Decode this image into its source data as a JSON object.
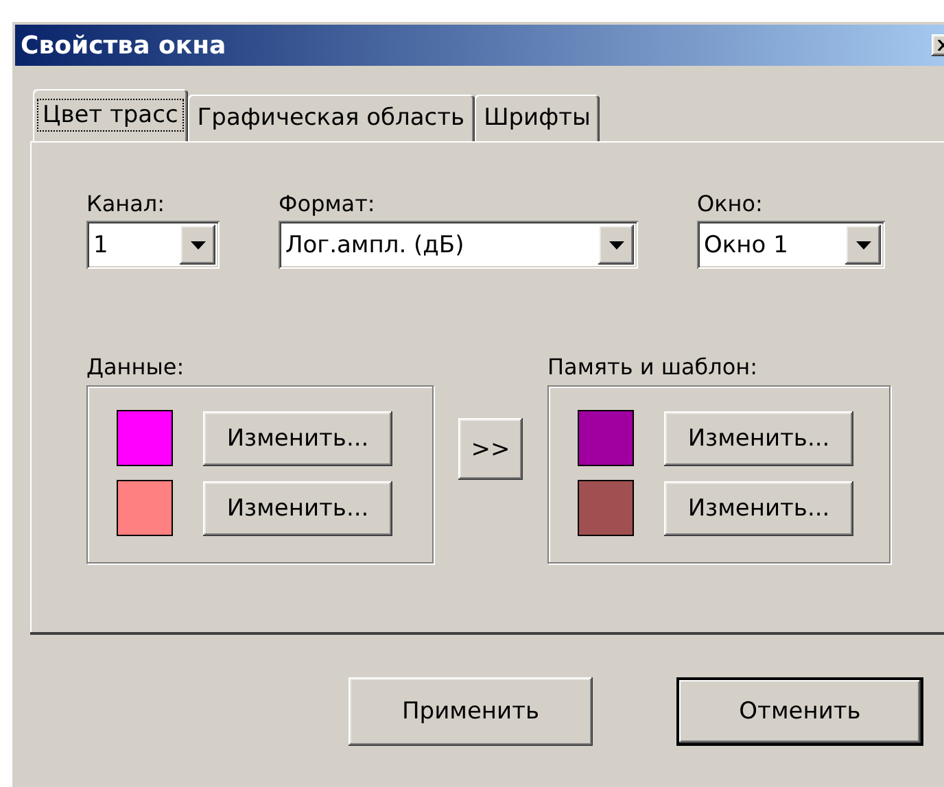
{
  "window": {
    "title": "Свойства окна"
  },
  "tabs": [
    {
      "label": "Цвет трасс",
      "selected": true
    },
    {
      "label": "Графическая область",
      "selected": false
    },
    {
      "label": "Шрифты",
      "selected": false
    }
  ],
  "selectors": [
    {
      "label": "Канал:",
      "value": "1"
    },
    {
      "label": "Формат:",
      "value": "Лог.ампл. (дБ)"
    },
    {
      "label": "Окно:",
      "value": "Окно 1"
    }
  ],
  "data_group": {
    "label": "Данные:",
    "rows": [
      {
        "color": "#ff00ff",
        "button": "Изменить..."
      },
      {
        "color": "#ff8080",
        "button": "Изменить..."
      }
    ]
  },
  "copy_button": ">>",
  "memory_group": {
    "label": "Память и шаблон:",
    "rows": [
      {
        "color": "#a000a0",
        "button": "Изменить..."
      },
      {
        "color": "#a05050",
        "button": "Изменить..."
      }
    ]
  },
  "buttons": [
    {
      "label": "Применить",
      "default": false
    },
    {
      "label": "Отменить",
      "default": true
    }
  ]
}
